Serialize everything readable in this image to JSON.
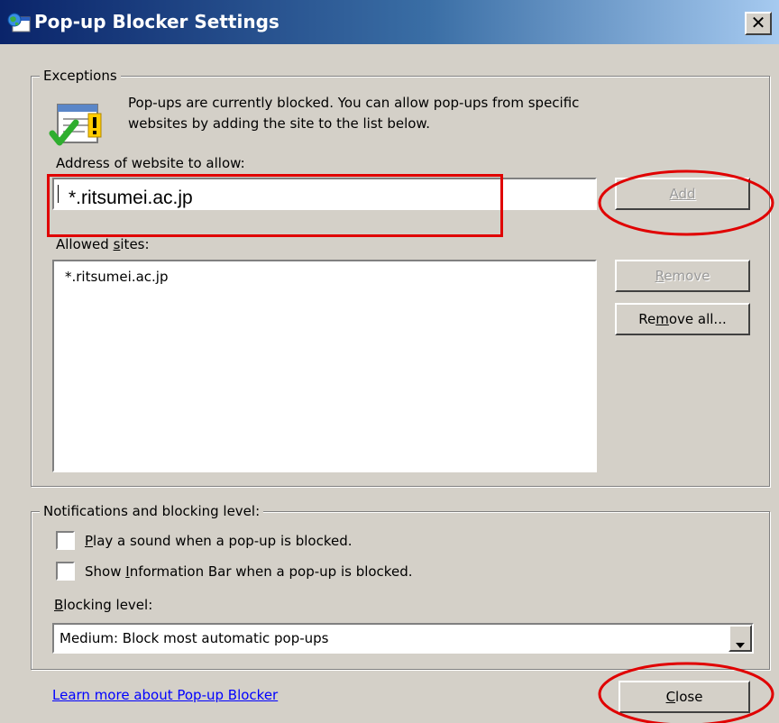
{
  "window": {
    "title": "Pop-up Blocker Settings",
    "close_glyph": "✕"
  },
  "exceptions": {
    "legend": "Exceptions",
    "description_line1": "Pop-ups are currently blocked.  You can allow pop-ups from specific",
    "description_line2": "websites by adding the site to the list below.",
    "address_label": "Address of website to allow:",
    "address_value": "*.ritsumei.ac.jp",
    "add_button": "Add",
    "allowed_label_pre": "Allowed ",
    "allowed_label_acc": "s",
    "allowed_label_post": "ites:",
    "allowed_sites": [
      "*.ritsumei.ac.jp"
    ],
    "remove_button_acc": "R",
    "remove_button_rest": "emove",
    "remove_all_pre": "Re",
    "remove_all_acc": "m",
    "remove_all_post": "ove all..."
  },
  "notifications": {
    "legend": "Notifications and blocking level:",
    "play_sound_acc": "P",
    "play_sound_rest": "lay a sound when a pop-up is blocked.",
    "play_sound_checked": false,
    "info_bar_pre": "Show ",
    "info_bar_acc": "I",
    "info_bar_post": "nformation Bar when a pop-up is blocked.",
    "info_bar_checked": false,
    "blocking_label_acc": "B",
    "blocking_label_rest": "locking level:",
    "blocking_level_value": "Medium: Block most automatic pop-ups"
  },
  "footer": {
    "learn_more": "Learn more about Pop-up Blocker",
    "close_acc": "C",
    "close_rest": "lose"
  },
  "annotations": {
    "color": "#e00000"
  }
}
